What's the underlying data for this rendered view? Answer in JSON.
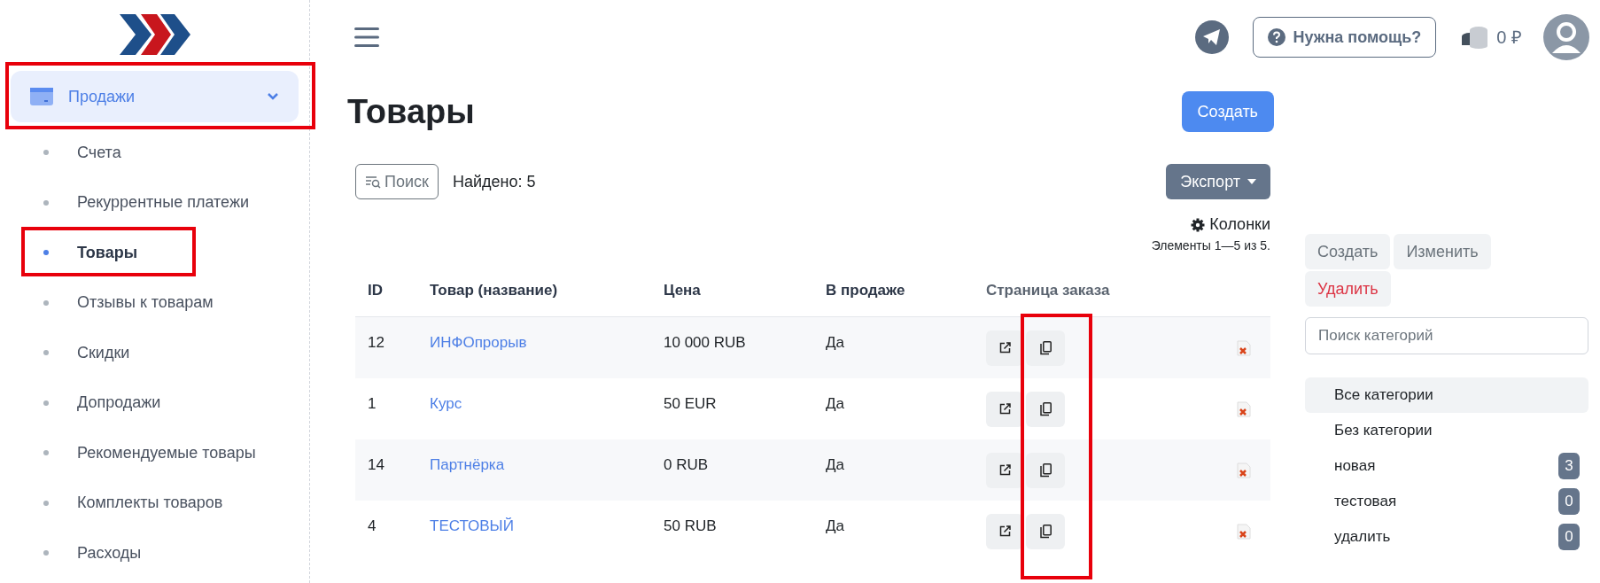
{
  "sidebar": {
    "group": {
      "label": "Продажи",
      "expanded": true,
      "highlighted": true
    },
    "items": [
      {
        "label": "Счета",
        "selected": false,
        "highlighted": false
      },
      {
        "label": "Рекуррентные платежи",
        "selected": false,
        "highlighted": false
      },
      {
        "label": "Товары",
        "selected": true,
        "highlighted": true
      },
      {
        "label": "Отзывы к товарам",
        "selected": false,
        "highlighted": false
      },
      {
        "label": "Скидки",
        "selected": false,
        "highlighted": false
      },
      {
        "label": "Допродажи",
        "selected": false,
        "highlighted": false
      },
      {
        "label": "Рекомендуемые товары",
        "selected": false,
        "highlighted": false
      },
      {
        "label": "Комплекты товаров",
        "selected": false,
        "highlighted": false
      },
      {
        "label": "Расходы",
        "selected": false,
        "highlighted": false
      }
    ]
  },
  "topbar": {
    "help_button": "Нужна помощь?",
    "balance": "0 ₽"
  },
  "page": {
    "title": "Товары",
    "create_button": "Создать",
    "search_button": "Поиск",
    "found": "Найдено: 5",
    "export_button": "Экспорт",
    "columns_link": "Колонки",
    "range": "Элементы 1—5 из 5."
  },
  "table": {
    "columns": [
      "ID",
      "Товар (название)",
      "Цена",
      "В продаже",
      "Страница заказа"
    ],
    "copy_column_highlighted": true,
    "rows": [
      {
        "id": "12",
        "name": "ИНФОпрорыв",
        "price": "10 000 RUB",
        "on_sale": "Да"
      },
      {
        "id": "1",
        "name": "Курс",
        "price": "50 EUR",
        "on_sale": "Да"
      },
      {
        "id": "14",
        "name": "Партнёрка",
        "price": "0 RUB",
        "on_sale": "Да"
      },
      {
        "id": "4",
        "name": "ТЕСТОВЫЙ",
        "price": "50 RUB",
        "on_sale": "Да"
      }
    ]
  },
  "categories": {
    "buttons": [
      {
        "label": "Создать",
        "kind": "normal"
      },
      {
        "label": "Изменить",
        "kind": "normal"
      },
      {
        "label": "Удалить",
        "kind": "danger"
      }
    ],
    "search_placeholder": "Поиск категорий",
    "items": [
      {
        "label": "Все категории",
        "selected": true
      },
      {
        "label": "Без категории",
        "selected": false
      },
      {
        "label": "новая",
        "count": "3",
        "selected": false
      },
      {
        "label": "тестовая",
        "count": "0",
        "selected": false
      },
      {
        "label": "удалить",
        "count": "0",
        "selected": false
      }
    ]
  }
}
